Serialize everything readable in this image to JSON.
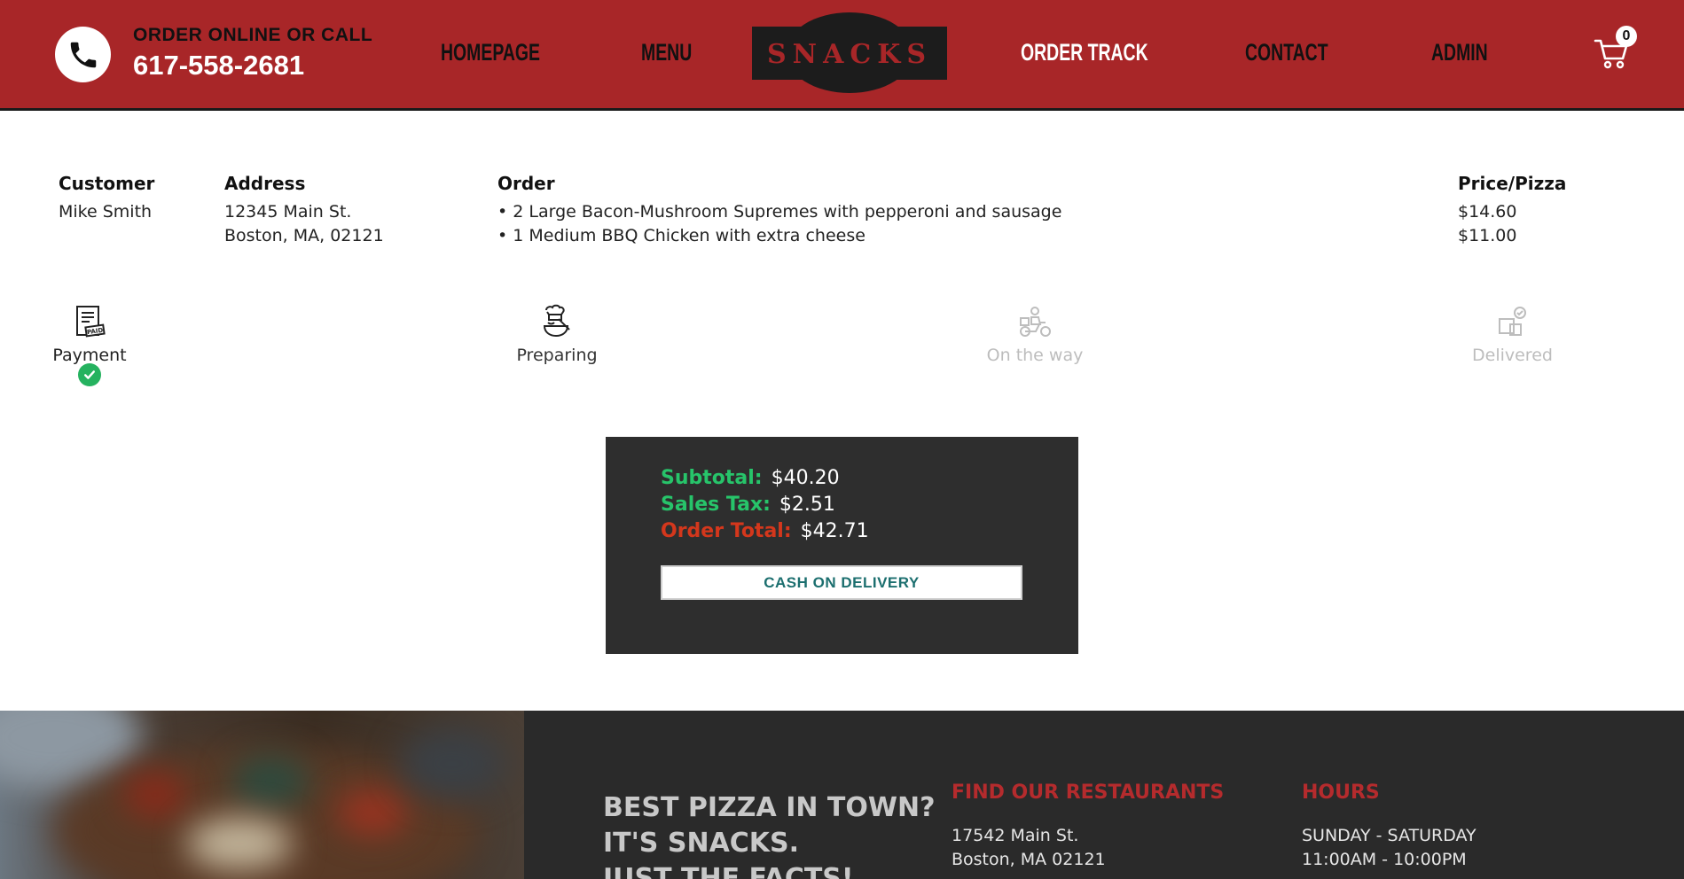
{
  "header": {
    "call_label": "ORDER ONLINE OR CALL",
    "phone_number": "617-558-2681",
    "logo_text": "SNACKS",
    "nav": [
      {
        "label": "HOMEPAGE"
      },
      {
        "label": "MENU"
      },
      {
        "label": "ORDER TRACK"
      },
      {
        "label": "CONTACT"
      },
      {
        "label": "ADMIN"
      }
    ],
    "cart_count": "0",
    "brand_color": "#a82628"
  },
  "order": {
    "headers": {
      "customer": "Customer",
      "address": "Address",
      "order": "Order",
      "price": "Price/Pizza"
    },
    "customer": "Mike Smith",
    "address_line1": "12345 Main St.",
    "address_line2": "Boston, MA, 02121",
    "items": [
      "• 2 Large Bacon-Mushroom Supremes with pepperoni and sausage",
      "• 1 Medium BBQ Chicken with extra cheese"
    ],
    "prices": [
      "$14.60",
      "$11.00"
    ]
  },
  "progress": {
    "steps": [
      {
        "label": "Payment",
        "icon": "receipt-paid-icon",
        "state": "done"
      },
      {
        "label": "Preparing",
        "icon": "chef-cooking-icon",
        "state": "current"
      },
      {
        "label": "On the way",
        "icon": "delivery-scooter-icon",
        "state": "pending"
      },
      {
        "label": "Delivered",
        "icon": "delivered-box-icon",
        "state": "pending"
      }
    ]
  },
  "totals": {
    "subtotal_label": "Subtotal:",
    "subtotal_value": "$40.20",
    "tax_label": "Sales Tax:",
    "tax_value": "$2.51",
    "total_label": "Order Total:",
    "total_value": "$42.71",
    "button_label": "CASH ON DELIVERY"
  },
  "footer": {
    "slogan_line1": "BEST PIZZA IN TOWN?",
    "slogan_line2": "IT'S SNACKS.",
    "slogan_line3": "JUST THE FACTS!",
    "restaurants_heading": "FIND OUR RESTAURANTS",
    "restaurant_line1": "17542 Main St.",
    "restaurant_line2": "Boston, MA 02121",
    "hours_heading": "HOURS",
    "hours_line1": "SUNDAY - SATURDAY",
    "hours_line2": "11:00AM - 10:00PM"
  }
}
